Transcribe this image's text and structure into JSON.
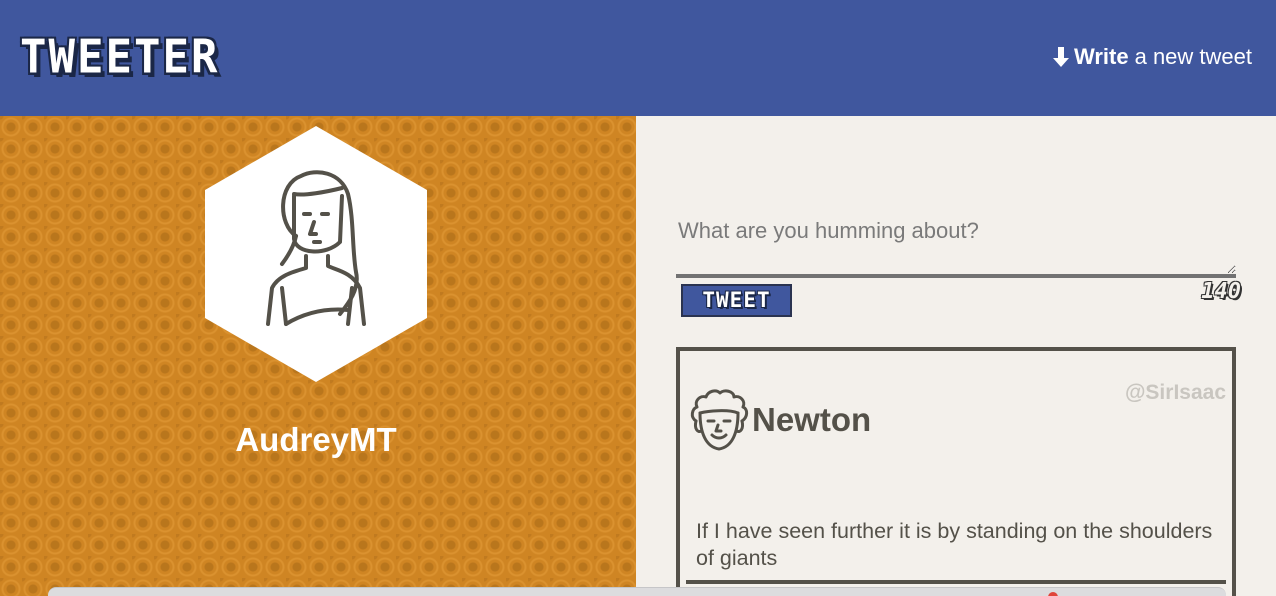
{
  "header": {
    "logo": "TWEETER",
    "compose_link": {
      "bold": "Write",
      "rest": "a new tweet",
      "icon": "arrow-down-icon"
    }
  },
  "profile": {
    "username": "AudreyMT",
    "avatar": "woman-avatar-icon"
  },
  "composer": {
    "placeholder": "What are you humming about?",
    "button_label": "TWEET",
    "char_count": "140"
  },
  "tweets": [
    {
      "author": "Newton",
      "handle": "@SirIsaac",
      "avatar": "curly-hair-man-avatar-icon",
      "text": "If I have seen further it is by standing on the shoulders of giants"
    }
  ],
  "colors": {
    "header_bg": "#40579e",
    "profile_bg": "#cf8523",
    "page_bg": "#f3f0eb",
    "border_dark": "#545149"
  }
}
